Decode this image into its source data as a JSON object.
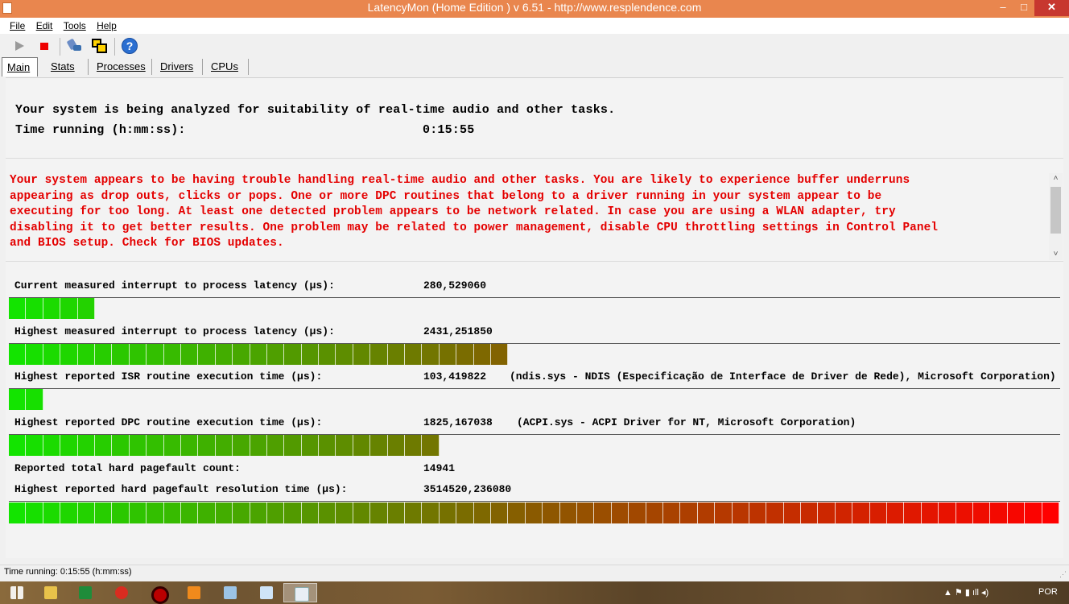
{
  "window": {
    "title": "LatencyMon  (Home Edition )  v 6.51 - http://www.resplendence.com",
    "minimize_glyph": "–",
    "maximize_glyph": "□",
    "close_glyph": "✕"
  },
  "menu": [
    "File",
    "Edit",
    "Tools",
    "Help"
  ],
  "toolbar": {
    "icons": [
      "play-icon",
      "stop-icon",
      "tools-icon",
      "windows-icon",
      "help-icon"
    ],
    "help_glyph": "?"
  },
  "tabs": [
    {
      "label": "Main",
      "active": true
    },
    {
      "label": "Stats",
      "active": false
    },
    {
      "label": "Processes",
      "active": false
    },
    {
      "label": "Drivers",
      "active": false
    },
    {
      "label": "CPUs",
      "active": false
    }
  ],
  "main": {
    "analyzing_text": "Your system is being analyzed for suitability of real-time audio and other tasks.",
    "time_running_label": "Time running (h:mm:ss):",
    "time_running_value": "0:15:55",
    "warning_lines": [
      "Your system appears to be having trouble handling real-time audio and other tasks. You are likely to experience buffer underruns",
      "appearing as drop outs, clicks or pops. One or more DPC routines that belong to a driver running in your system appear to be",
      "executing for too long. At least one detected problem appears to be network related. In case you are using a WLAN adapter, try",
      "disabling it to get better results. One problem may be related to power management, disable CPU throttling settings in Control Panel",
      "and BIOS setup. Check for BIOS updates."
    ],
    "scroll_up_glyph": "˄",
    "scroll_down_glyph": "˅",
    "metrics": [
      {
        "label": "Current measured interrupt to process latency (µs):",
        "value": "280,529060",
        "extra": "",
        "bar_segments": 5
      },
      {
        "label": "Highest measured interrupt to process latency (µs):",
        "value": "2431,251850",
        "extra": "",
        "bar_segments": 29
      },
      {
        "label": "Highest reported ISR routine execution time (µs):",
        "value": "103,419822",
        "extra": "(ndis.sys - NDIS (Especificação de Interface de Driver de Rede), Microsoft Corporation)",
        "bar_segments": 2
      },
      {
        "label": "Highest reported DPC routine execution time (µs):",
        "value": "1825,167038",
        "extra": "(ACPI.sys - ACPI Driver for NT, Microsoft Corporation)",
        "bar_segments": 25
      }
    ],
    "pagefault_count_label": "Reported total hard pagefault count:",
    "pagefault_count_value": "14941",
    "pagefault_time_label": "Highest reported hard pagefault resolution time (µs):",
    "pagefault_time_value": "3514520,236080",
    "pagefault_bar_segments": 61,
    "bar_total_segments": 61
  },
  "status_bar": {
    "text": "Time running: 0:15:55  (h:mm:ss)"
  },
  "taskbar": {
    "apps": [
      "start-icon",
      "file-explorer-icon",
      "excel-icon",
      "chrome-icon",
      "opera-icon",
      "media-player-icon",
      "outlook-icon",
      "notepad-icon",
      "latencymon-icon"
    ],
    "language": "POR",
    "tray_glyphs": "▲  ⚑  ▮  ıll  ◂)"
  },
  "colors": {
    "titlebar": "#e9864e",
    "close_button": "#c7372f",
    "warning_text": "#e40000",
    "bar_start": "#13e400",
    "bar_mid": "#8a5a00",
    "bar_end": "#ff0000"
  }
}
